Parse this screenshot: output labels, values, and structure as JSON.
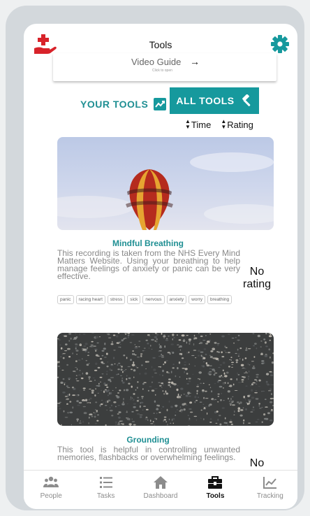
{
  "header": {
    "title": "Tools",
    "help_icon": "hand-medical-icon",
    "settings_icon": "gear-icon",
    "video_guide": {
      "label": "Video Guide",
      "sub_label": "Click to open",
      "arrow": "→"
    }
  },
  "toggle": {
    "your_tools": "YOUR TOOLS",
    "all_tools": "ALL TOOLS"
  },
  "sort": {
    "time": "Time",
    "rating": "Rating"
  },
  "tools": [
    {
      "title": "Mindful Breathing",
      "description": "This recording is taken from the NHS Every Mind Matters Website. Using your breathing to help manage feelings of anxiety or panic can be very effective.",
      "rating": "No rating",
      "tags": [
        "panic",
        "racing heart",
        "stress",
        "sick",
        "nervous",
        "anxiety",
        "worry",
        "breathing"
      ]
    },
    {
      "title": "Grounding",
      "description": "This tool is helpful in controlling unwanted memories, flashbacks or overwhelming feelings.",
      "rating": "No"
    }
  ],
  "nav": [
    {
      "label": "People",
      "icon": "people-icon"
    },
    {
      "label": "Tasks",
      "icon": "list-icon"
    },
    {
      "label": "Dashboard",
      "icon": "home-icon"
    },
    {
      "label": "Tools",
      "icon": "toolbox-icon",
      "active": true
    },
    {
      "label": "Tracking",
      "icon": "chart-icon"
    }
  ],
  "colors": {
    "accent": "#16999d",
    "danger": "#d8232a",
    "text_muted": "#888888"
  }
}
